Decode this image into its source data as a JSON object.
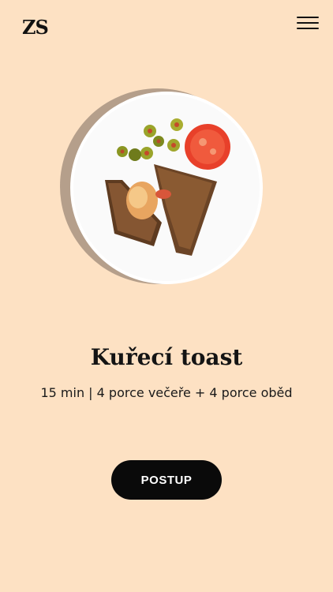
{
  "header": {
    "logo": "ZS",
    "menu_icon": "hamburger-menu-icon"
  },
  "recipe": {
    "title": "Kuřecí toast",
    "meta": "15 min | 4 porce večeře + 4 porce oběd",
    "image": "plate-with-toast-olives-tomato"
  },
  "actions": {
    "start_label": "POSTUP"
  },
  "colors": {
    "background": "#fde1c3",
    "button": "#0a0a0a",
    "button_text": "#ffffff"
  }
}
